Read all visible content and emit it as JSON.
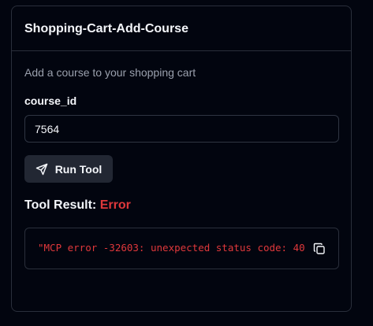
{
  "tool": {
    "title": "Shopping-Cart-Add-Course",
    "description": "Add a course to your shopping cart"
  },
  "form": {
    "course_id_label": "course_id",
    "course_id_value": "7564"
  },
  "actions": {
    "run_label": "Run Tool",
    "run_icon": "send-icon"
  },
  "result": {
    "heading": "Tool Result:",
    "status": "Error",
    "message": "\"MCP error -32603: unexpected status code: 40",
    "copy_icon": "copy-icon"
  },
  "colors": {
    "background": "#02050f",
    "border": "#2a2f3b",
    "button_bg": "#222733",
    "error": "#e0383b",
    "muted_text": "#9aa0ad",
    "text": "#f4f6fa"
  }
}
